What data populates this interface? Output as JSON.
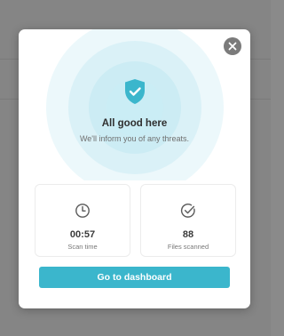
{
  "dialog": {
    "status_title": "All good here",
    "status_subtitle": "We'll inform you of any threats.",
    "stats": [
      {
        "value": "00:57",
        "label": "Scan time",
        "icon": "clock-icon"
      },
      {
        "value": "88",
        "label": "Files scanned",
        "icon": "check-circle-icon"
      }
    ],
    "cta_label": "Go to dashboard",
    "close_icon": "close-icon"
  },
  "colors": {
    "accent": "#3bb6cc",
    "shield": "#3bb6cc",
    "backdrop": "#858585"
  }
}
